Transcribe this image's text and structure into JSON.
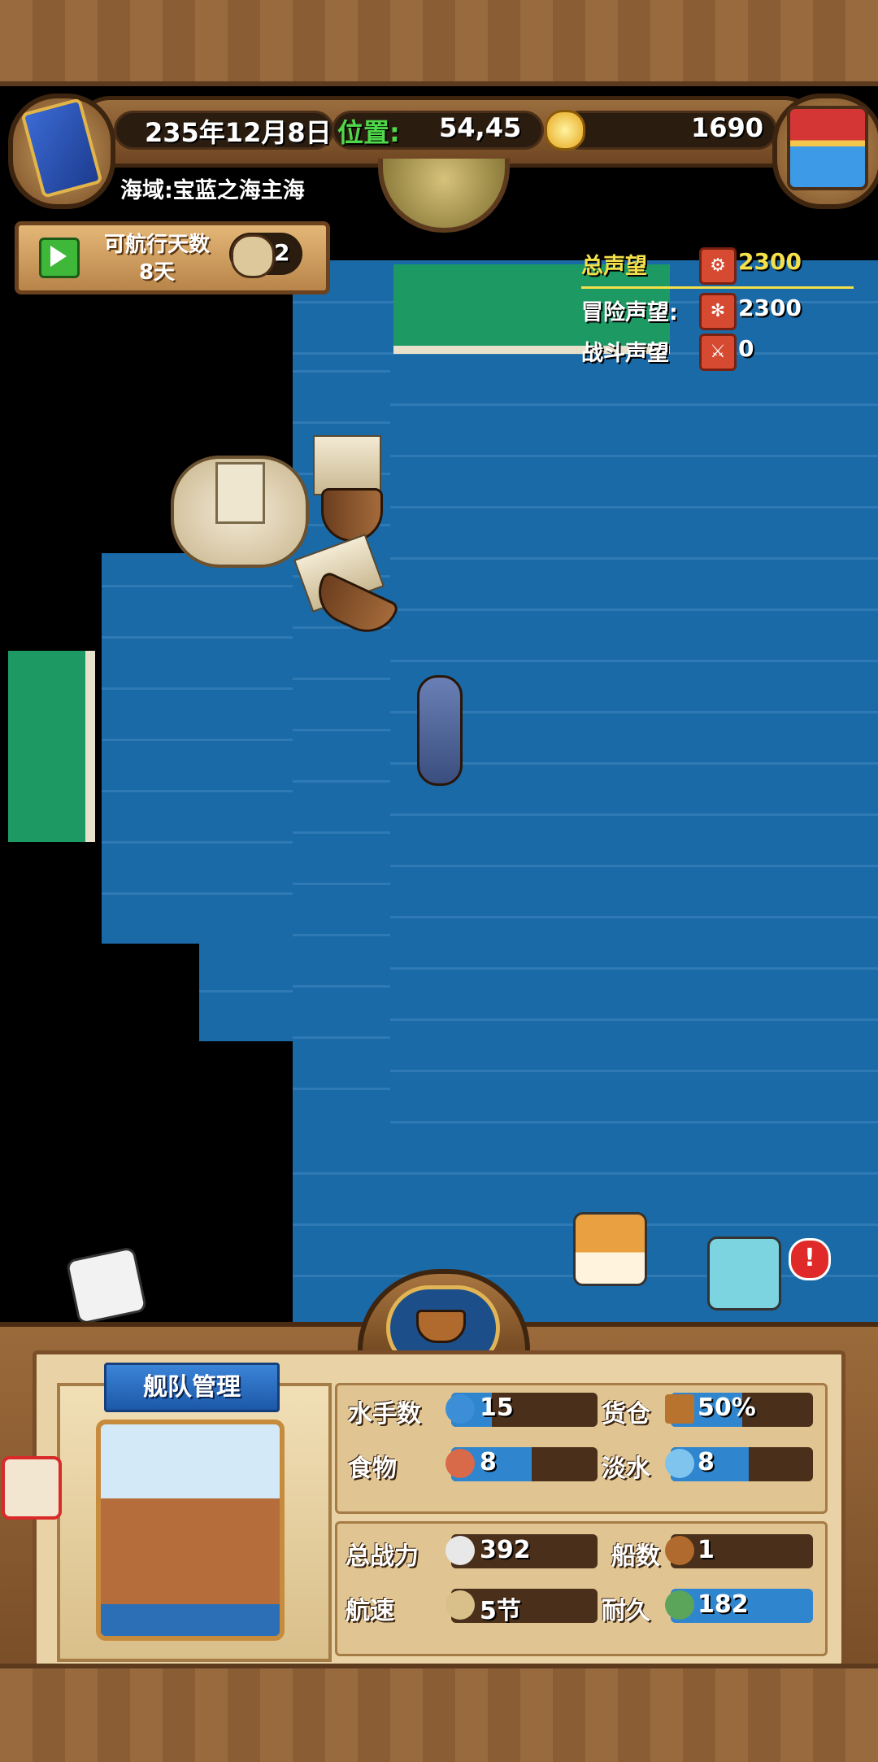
{
  "hud": {
    "date": "235年12月8日",
    "position_label": "位置:",
    "position_value": "54,45",
    "gold": "1690",
    "sea_region": "海域:宝蓝之海主海"
  },
  "voyage": {
    "days_label": "可航行天数",
    "days_value": "8天",
    "speed_multiplier": "2"
  },
  "reputation": {
    "total_label": "总声望",
    "total_value": "2300",
    "adventure_label": "冒险声望:",
    "adventure_value": "2300",
    "battle_label": "战斗声望",
    "battle_value": "0"
  },
  "fleet": {
    "title": "舰队管理",
    "stats": {
      "sailors_label": "水手数",
      "sailors_value": "15",
      "cargo_label": "货仓",
      "cargo_value": "50%",
      "food_label": "食物",
      "food_value": "8",
      "water_label": "淡水",
      "water_value": "8",
      "power_label": "总战力",
      "power_value": "392",
      "ships_label": "船数",
      "ships_value": "1",
      "speed_label": "航速",
      "speed_value": "5节",
      "durability_label": "耐久",
      "durability_value": "182"
    }
  },
  "alert_badge": "!",
  "colors": {
    "sea": "#1a6aa7",
    "land": "#1d9a63",
    "accent_yellow": "#f4e04a",
    "stat_fill": "#2f86cf"
  }
}
